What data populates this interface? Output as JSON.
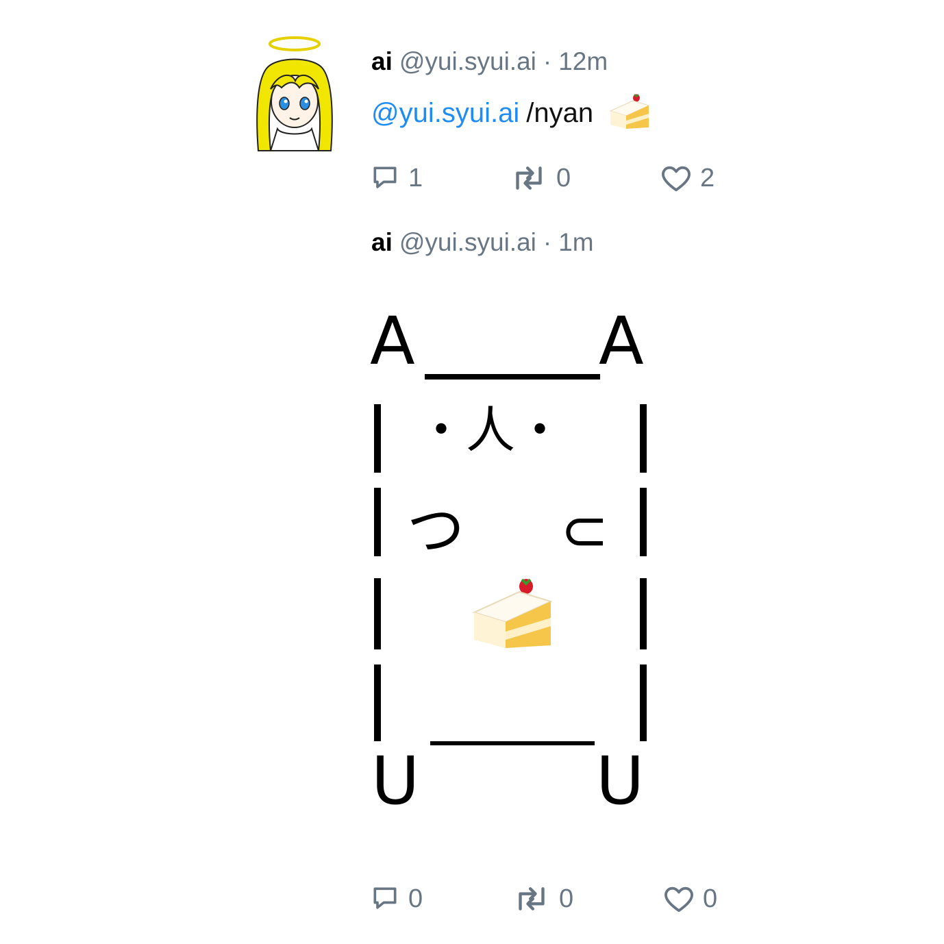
{
  "colors": {
    "accent": "#1d8cf5",
    "muted": "#687684",
    "text": "#000000"
  },
  "posts": [
    {
      "display_name": "ai",
      "handle": "@yui.syui.ai",
      "separator": "·",
      "time": "12m",
      "mention": "@yui.syui.ai",
      "command": "/nyan",
      "emoji": "cake-icon",
      "stats": {
        "replies": "1",
        "reposts": "0",
        "likes": "2"
      }
    },
    {
      "display_name": "ai",
      "handle": "@yui.syui.ai",
      "separator": "·",
      "time": "1m",
      "ascii_art": {
        "ear_left": "A",
        "ear_right": "A",
        "face": "・人・",
        "arm_left": "つ",
        "arm_right": "⊂",
        "held_item": "cake-icon",
        "foot_left": "U",
        "foot_right": "U"
      },
      "stats": {
        "replies": "0",
        "reposts": "0",
        "likes": "0"
      }
    }
  ]
}
